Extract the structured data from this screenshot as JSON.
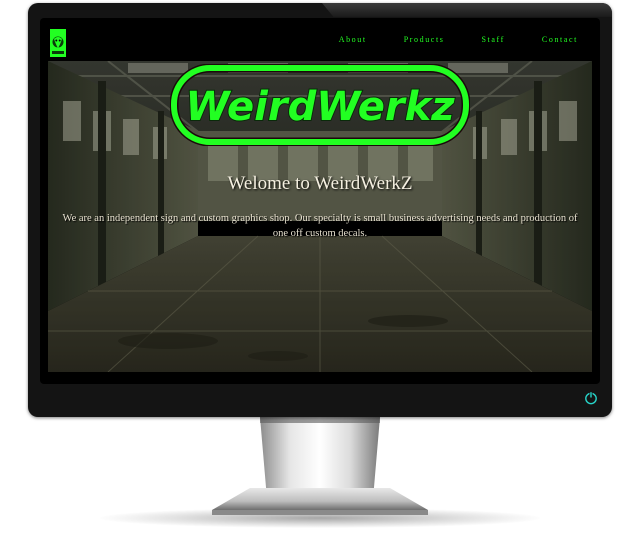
{
  "site": {
    "brand": "WeirdWerkz",
    "nav": [
      {
        "label": "About"
      },
      {
        "label": "Products"
      },
      {
        "label": "Staff"
      },
      {
        "label": "Contact"
      }
    ]
  },
  "hero": {
    "title": "Welome to WeirdWerkZ",
    "text": "We are an independent sign and custom graphics shop. Our specialty is small business advertising needs and production of one off custom decals."
  },
  "colors": {
    "accent": "#22ff22",
    "monitor": "#141414"
  },
  "icons": {
    "logo": "weirdwerkz-emblem-icon",
    "power": "power-icon"
  }
}
